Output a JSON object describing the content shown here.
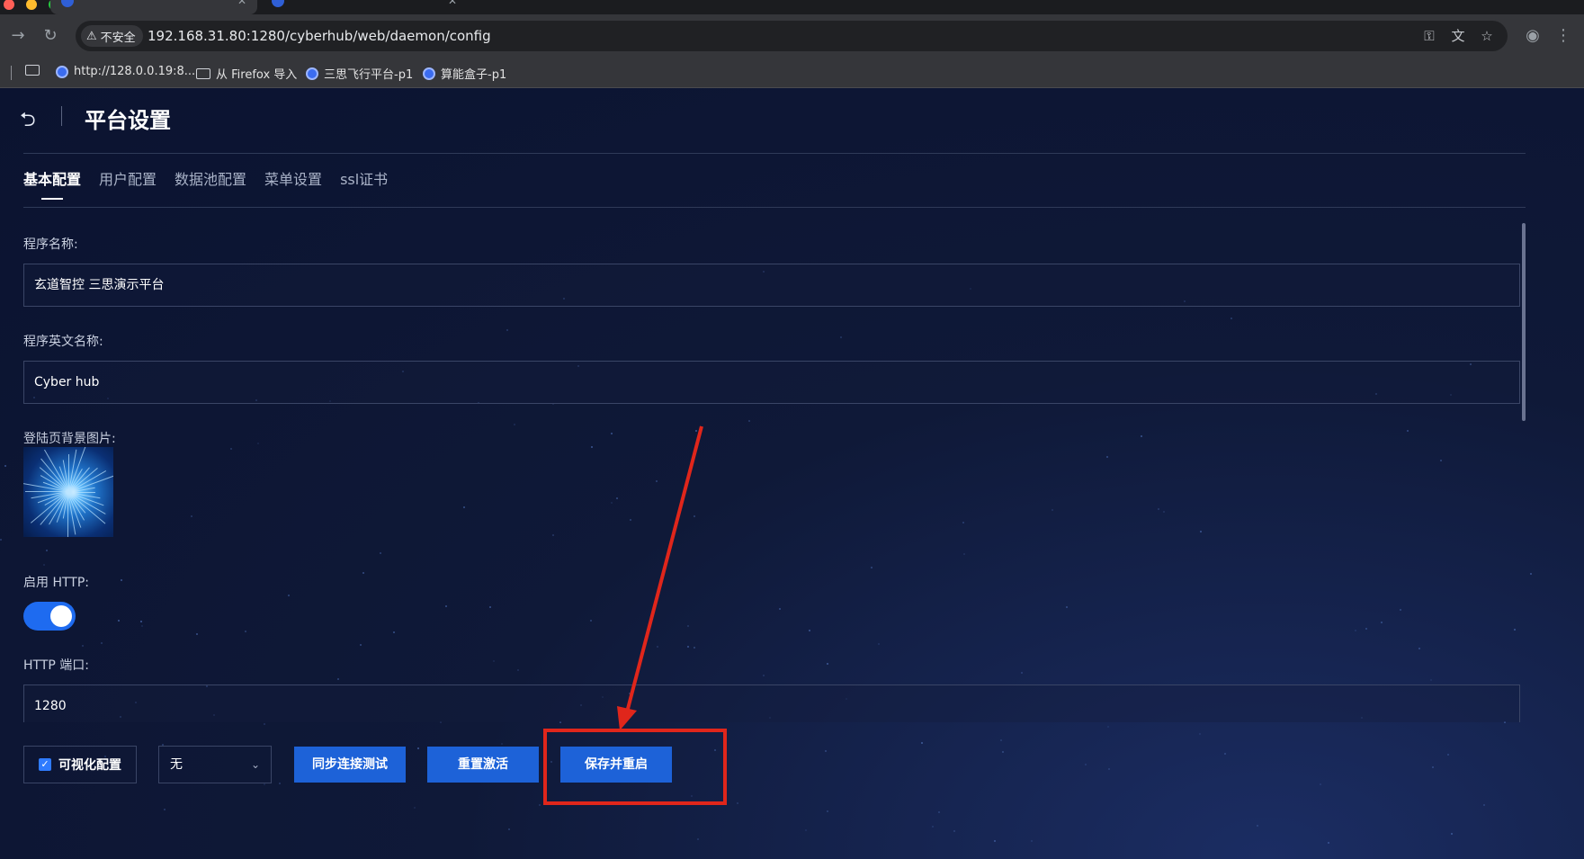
{
  "browser": {
    "tabs": [
      {
        "title": "",
        "active": true
      },
      {
        "title": "",
        "active": false
      }
    ],
    "security_chip": "不安全",
    "url": "192.168.31.80:1280/cyberhub/web/daemon/config",
    "bookmarks": [
      {
        "label": "http://128.0.0.19:8...",
        "icon": "globe-icon"
      },
      {
        "label": "从 Firefox 导入",
        "icon": "folder-icon"
      },
      {
        "label": "三思飞行平台-p1",
        "icon": "globe-icon"
      },
      {
        "label": "算能盒子-p1",
        "icon": "globe-icon"
      }
    ]
  },
  "page": {
    "title": "平台设置",
    "tabs": [
      "基本配置",
      "用户配置",
      "数据池配置",
      "菜单设置",
      "ssl证书"
    ],
    "active_tab": "基本配置"
  },
  "form": {
    "app_name_label": "程序名称:",
    "app_name_value": "玄道智控 三思演示平台",
    "app_en_name_label": "程序英文名称:",
    "app_en_name_value": "Cyber hub",
    "login_bg_label": "登陆页背景图片:",
    "http_enable_label": "启用 HTTP:",
    "http_enabled": true,
    "http_port_label": "HTTP 端口:",
    "http_port_value": "1280"
  },
  "actions": {
    "visual_config_label": "可视化配置",
    "visual_config_checked": true,
    "select_value": "无",
    "sync_test_label": "同步连接测试",
    "reset_activate_label": "重置激活",
    "save_restart_label": "保存并重启"
  },
  "colors": {
    "accent": "#1d62d8",
    "annotation": "#e0261b",
    "background": "#0d1530"
  }
}
